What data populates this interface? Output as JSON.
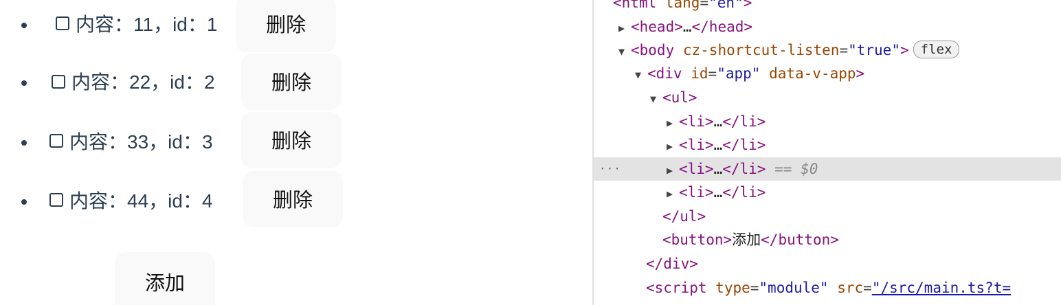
{
  "app": {
    "items": [
      {
        "text": "内容：11，id：1",
        "delete_label": "删除"
      },
      {
        "text": "内容：22，id：2",
        "delete_label": "删除"
      },
      {
        "text": "内容：33，id：3",
        "delete_label": "删除"
      },
      {
        "text": "内容：44，id：4",
        "delete_label": "删除"
      }
    ],
    "add_label": "添加"
  },
  "devtools": {
    "html_open": {
      "tag": "<html",
      "attr": "lang",
      "val": "\"en\"",
      "close": ">"
    },
    "head": {
      "open": "<head>",
      "ellipsis": "…",
      "close": "</head>"
    },
    "body": {
      "open": "<body",
      "attr": "cz-shortcut-listen",
      "val": "\"true\"",
      "close": ">",
      "badge": "flex"
    },
    "div_app": {
      "open": "<div",
      "attr1": "id",
      "val1": "\"app\"",
      "attr2": "data-v-app",
      "close": ">"
    },
    "ul_open": "<ul>",
    "li": {
      "open": "<li>",
      "ellipsis": "…",
      "close": "</li>"
    },
    "selected_marker": "==",
    "selected_ref": "$0",
    "ul_close": "</ul>",
    "button": {
      "open": "<button>",
      "text": "添加",
      "close": "</button>"
    },
    "div_close": "</div>",
    "script": {
      "open": "<script",
      "attr1": "type",
      "val1": "\"module\"",
      "attr2": "src",
      "val2": "\"/src/main.ts?t="
    },
    "more_indicator": "···"
  }
}
